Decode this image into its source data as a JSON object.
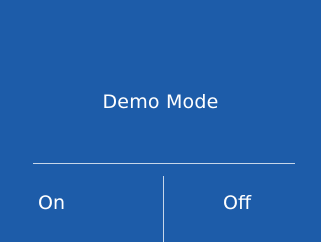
{
  "dialog": {
    "title": "Demo Mode",
    "buttons": {
      "on_label": "On",
      "off_label": "Off"
    }
  },
  "colors": {
    "background": "#1d5ca9",
    "text": "#ffffff"
  }
}
